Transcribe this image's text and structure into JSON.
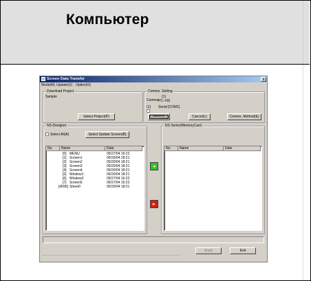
{
  "header": {
    "title": "Компьютер"
  },
  "window": {
    "title": "Screen Data Transfer",
    "close_glyph": "x",
    "menu": [
      "Mode(M)",
      "Update(U)",
      "Option(O)"
    ]
  },
  "download_project": {
    "caption": "Download Project",
    "value": "Sample",
    "select_button": "Select Project(P)"
  },
  "comms_setting": {
    "caption": "Comms. Setting",
    "comms_label": "Comms.",
    "unit_index": "(1)",
    "comms_value": "PC--NS",
    "port_index": "(1)",
    "port_value": "Serial [COM1]",
    "connect_button": "Connect(C)",
    "cancel_button": "Cancel(L)",
    "method_button": "Comms. Method(E)"
  },
  "ns_designer": {
    "caption": "NS-Designer",
    "select_all_label": "Select All(A)",
    "select_update_button": "Select Update Screen(B)",
    "columns": [
      "No.",
      "Name",
      "Date"
    ],
    "rows": [
      {
        "no": "[0]",
        "name": "MENU",
        "date": "05/27/04 16:22"
      },
      {
        "no": "[1]",
        "name": "Screen1",
        "date": "05/20/04 18:21"
      },
      {
        "no": "[2]",
        "name": "Screen2",
        "date": "05/20/04 18:21"
      },
      {
        "no": "[3]",
        "name": "Screen3",
        "date": "05/20/04 18:21"
      },
      {
        "no": "[4]",
        "name": "Screen4",
        "date": "05/20/04 18:21"
      },
      {
        "no": "[5]",
        "name": "Window1",
        "date": "05/20/04 18:21"
      },
      {
        "no": "[6]",
        "name": "Window2",
        "date": "05/27/04 16:22"
      },
      {
        "no": "[7]",
        "name": "Screen5",
        "date": "05/27/04 16:22"
      },
      {
        "no": "[4095]",
        "name": "Sheet0",
        "date": "05/20/04 18:21"
      }
    ]
  },
  "ns_series": {
    "caption": "NS Series/MemoryCard",
    "columns": [
      "No.",
      "Name",
      "Date"
    ]
  },
  "footer": {
    "apply_button": "Apply",
    "exit_button": "Exit"
  },
  "colors": {
    "upload_button": "#2fbf3a",
    "download_button": "#d81a1a",
    "titlebar_start": "#0a246a",
    "titlebar_end": "#a6caf0"
  },
  "icons": {
    "upload": "transfer-to-pc-icon",
    "download": "transfer-to-ns-icon",
    "app": "app-icon"
  }
}
